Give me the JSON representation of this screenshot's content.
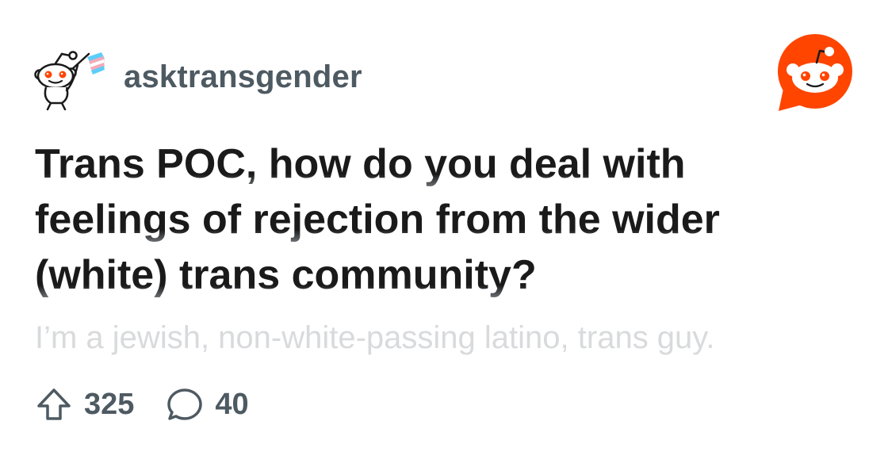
{
  "subreddit": {
    "name": "asktransgender",
    "avatar_icon": "snoo-trans-flag-icon"
  },
  "brand": {
    "logo_icon": "reddit-logo-icon",
    "accent": "#ff4500"
  },
  "post": {
    "title": "Trans POC, how do you deal with feelings of rejection from the wider (white) trans community?",
    "body_preview": "I’m a jewish, non-white-passing latino, trans guy."
  },
  "stats": {
    "upvote_icon": "upvote-arrow-icon",
    "upvotes": "325",
    "comment_icon": "comment-bubble-icon",
    "comments": "40"
  }
}
